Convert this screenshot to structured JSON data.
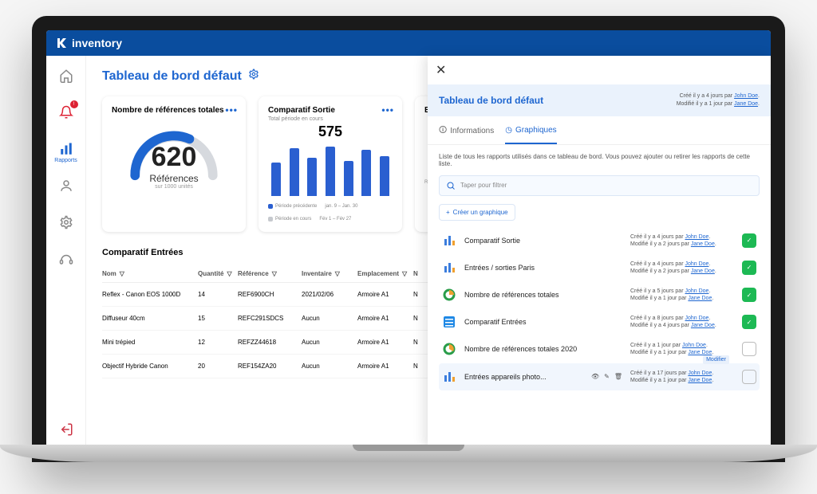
{
  "app_name": "inventory",
  "sidebar": {
    "active_label": "Rapports",
    "notif_count": "!"
  },
  "page": {
    "title": "Tableau de bord défaut"
  },
  "cards": {
    "gauge": {
      "title": "Nombre de références totales",
      "value": "620",
      "label": "Références",
      "sublabel": "sur 1000 unités"
    },
    "bars": {
      "title": "Comparatif Sortie",
      "subtitle": "Total période en cours",
      "value": "575",
      "legend1": "Période précédente",
      "legend2": "Période en cours",
      "range1": "jan. 9 – Jan. 30",
      "range2": "Fév 1 – Fév 27"
    },
    "third": {
      "title": "Entrées /"
    }
  },
  "chart_data": {
    "type": "bar",
    "title": "Comparatif Sortie – Total période en cours",
    "value_total": 575,
    "bars_relative_heights": [
      42,
      60,
      48,
      62,
      44,
      58,
      50
    ],
    "legend": [
      "Période précédente",
      "Période en cours"
    ],
    "period_ranges": [
      "jan. 9 – Jan. 30",
      "Fév 1 – Fév 27"
    ],
    "gauge": {
      "type": "gauge",
      "value": 620,
      "max": 1000,
      "label": "Références"
    }
  },
  "table": {
    "title": "Comparatif Entrées",
    "headers": {
      "nom": "Nom",
      "qte": "Quantité",
      "ref": "Référence",
      "inv": "Inventaire",
      "emp": "Emplacement",
      "x": "N"
    },
    "rows": [
      {
        "nom": "Reflex - Canon EOS 1000D",
        "qte": "14",
        "ref": "REF6900CH",
        "inv": "2021/02/06",
        "emp": "Armoire A1",
        "x": "N"
      },
      {
        "nom": "Diffuseur 40cm",
        "qte": "15",
        "ref": "REFC291SDCS",
        "inv": "Aucun",
        "emp": "Armoire A1",
        "x": "N"
      },
      {
        "nom": "Mini trépied",
        "qte": "12",
        "ref": "REFZZ44618",
        "inv": "Aucun",
        "emp": "Armoire A1",
        "x": "N"
      },
      {
        "nom": "Objectif Hybride Canon",
        "qte": "20",
        "ref": "REF154ZA20",
        "inv": "Aucun",
        "emp": "Armoire A1",
        "x": "N"
      }
    ]
  },
  "drawer": {
    "title": "Tableau de bord défaut",
    "created": "Créé il y a 4 jours par ",
    "created_by": "John Doe",
    "modified": "Modifié il y a 1 jour par ",
    "modified_by": "Jane Doe",
    "tabs": {
      "info": "Informations",
      "graph": "Graphiques"
    },
    "desc": "Liste de tous les rapports utilisés dans ce tableau de bord. Vous pouvez ajouter ou retirer les rapports de cette liste.",
    "filter_placeholder": "Taper pour filtrer",
    "create_btn": "Créer un graphique",
    "tooltip_edit": "Modifier",
    "items": [
      {
        "name": "Comparatif Sortie",
        "c1": "Créé il y a 4 jours par ",
        "c1b": "John Doe",
        "c2": "Modifié il y a 2 jours par ",
        "c2b": "Jane Doe",
        "on": true
      },
      {
        "name": "Entrées / sorties Paris",
        "c1": "Créé il y a 4 jours par ",
        "c1b": "John Doe",
        "c2": "Modifié il y a 2 jours par ",
        "c2b": "Jane Doe",
        "on": true
      },
      {
        "name": "Nombre de références totales",
        "c1": "Créé il y a 5 jours par ",
        "c1b": "John Doe",
        "c2": "Modifié il y a 1 jour par ",
        "c2b": "Jane Doe",
        "on": true
      },
      {
        "name": "Comparatif Entrées",
        "c1": "Créé il y a 8 jours par ",
        "c1b": "John Doe",
        "c2": "Modifié il y a 4 jours par ",
        "c2b": "Jane Doe",
        "on": true
      },
      {
        "name": "Nombre de références totales 2020",
        "c1": "Créé il y a 1 jour par ",
        "c1b": "John Doe",
        "c2": "Modifié il y a 1 jour par ",
        "c2b": "Jane Doe",
        "on": false
      },
      {
        "name": "Entrées appareils photo...",
        "c1": "Créé il y a 17 jours par ",
        "c1b": "John Doe",
        "c2": "Modifié il y a 1 jour par ",
        "c2b": "Jane Doe",
        "on": false,
        "hot": true
      }
    ]
  }
}
